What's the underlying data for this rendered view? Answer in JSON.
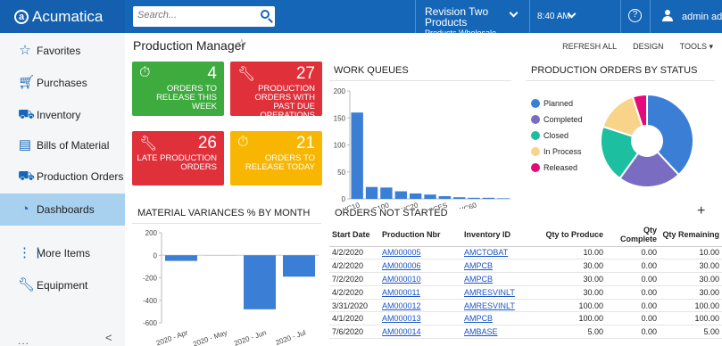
{
  "app": {
    "logo_text": "Acumatica"
  },
  "search": {
    "placeholder": "Search..."
  },
  "company": {
    "name": "Revision Two Products",
    "branch": "Products Wholesale"
  },
  "time": "8:40 AM",
  "help_label": "?",
  "user": {
    "name": "admin admin"
  },
  "sidebar": {
    "items": [
      {
        "label": "Favorites",
        "icon": "star-icon"
      },
      {
        "label": "Purchases",
        "icon": "cart-icon"
      },
      {
        "label": "Inventory",
        "icon": "truck-icon"
      },
      {
        "label": "Bills of Material",
        "icon": "document-icon"
      },
      {
        "label": "Production Orders",
        "icon": "truck-icon"
      },
      {
        "label": "Dashboards",
        "icon": "gauge-icon"
      },
      {
        "label": "More Items",
        "icon": "grid-icon"
      },
      {
        "label": "Equipment",
        "icon": "wrench-icon"
      }
    ],
    "dots": "...",
    "collapse": "<"
  },
  "page": {
    "title": "Production Manager",
    "links": [
      "REFRESH ALL",
      "DESIGN",
      "TOOLS ▾"
    ]
  },
  "tiles": [
    {
      "value": "4",
      "label": "ORDERS TO RELEASE THIS WEEK",
      "icon": "stopwatch-icon",
      "color": "#3eab3f"
    },
    {
      "value": "27",
      "label": "PRODUCTION ORDERS WITH PAST DUE OPERATIONS",
      "icon": "wrench-icon",
      "color": "#e0303a"
    },
    {
      "value": "26",
      "label": "LATE PRODUCTION ORDERS",
      "icon": "wrench-icon",
      "color": "#e0303a"
    },
    {
      "value": "21",
      "label": "ORDERS TO RELEASE TODAY",
      "icon": "stopwatch-icon",
      "color": "#f8b600"
    }
  ],
  "widgets": {
    "work_queues": "WORK QUEUES",
    "status": "PRODUCTION ORDERS BY STATUS",
    "variances": "MATERIAL VARIANCES % BY MONTH",
    "not_started": "ORDERS NOT STARTED",
    "add_label": "+"
  },
  "chart_data": [
    {
      "type": "bar",
      "title": "WORK QUEUES",
      "categories": [
        "WC10",
        "",
        "WC100",
        "",
        "WC20",
        "",
        "AASERVICES",
        "",
        "WC60",
        "",
        ""
      ],
      "values": [
        160,
        22,
        21,
        14,
        10,
        8,
        5,
        3,
        2,
        2,
        1
      ],
      "ylim": [
        0,
        200
      ],
      "yticks": [
        0,
        50,
        100,
        150,
        200
      ],
      "color": "#3b7ed6"
    },
    {
      "type": "pie",
      "title": "PRODUCTION ORDERS BY STATUS",
      "labels": [
        "Planned",
        "Completed",
        "Closed",
        "In Process",
        "Released"
      ],
      "values": [
        38,
        22,
        20,
        15,
        5
      ],
      "colors": [
        "#3b7ed6",
        "#7a6cc1",
        "#1cbfa0",
        "#f8d38a",
        "#e6097a"
      ]
    },
    {
      "type": "bar",
      "title": "MATERIAL VARIANCES % BY MONTH",
      "categories": [
        "2020 - Apr",
        "2020 - May",
        "2020 - Jun",
        "2020 - Jul"
      ],
      "values": [
        -50,
        0,
        -480,
        -190
      ],
      "ylim": [
        -600,
        200
      ],
      "yticks": [
        200,
        0,
        -200,
        -400,
        -600
      ],
      "color": "#3b7ed6"
    }
  ],
  "orders_table": {
    "headers": [
      "Start Date",
      "Production Nbr",
      "Inventory ID",
      "Qty to Produce",
      "Qty Complete",
      "Qty Remaining"
    ],
    "rows": [
      [
        "4/2/2020",
        "AM000005",
        "AMCTOBAT",
        "10.00",
        "0.00",
        "10.00"
      ],
      [
        "4/2/2020",
        "AM000006",
        "AMPCB",
        "30.00",
        "0.00",
        "30.00"
      ],
      [
        "7/2/2020",
        "AM000010",
        "AMPCB",
        "30.00",
        "0.00",
        "30.00"
      ],
      [
        "4/2/2020",
        "AM000011",
        "AMRESVINLT",
        "30.00",
        "0.00",
        "30.00"
      ],
      [
        "3/31/2020",
        "AM000012",
        "AMRESVINLT",
        "100.00",
        "0.00",
        "100.00"
      ],
      [
        "4/1/2020",
        "AM000013",
        "AMPCB",
        "100.00",
        "0.00",
        "100.00"
      ],
      [
        "7/6/2020",
        "AM000014",
        "AMBASE",
        "5.00",
        "0.00",
        "5.00"
      ]
    ]
  }
}
